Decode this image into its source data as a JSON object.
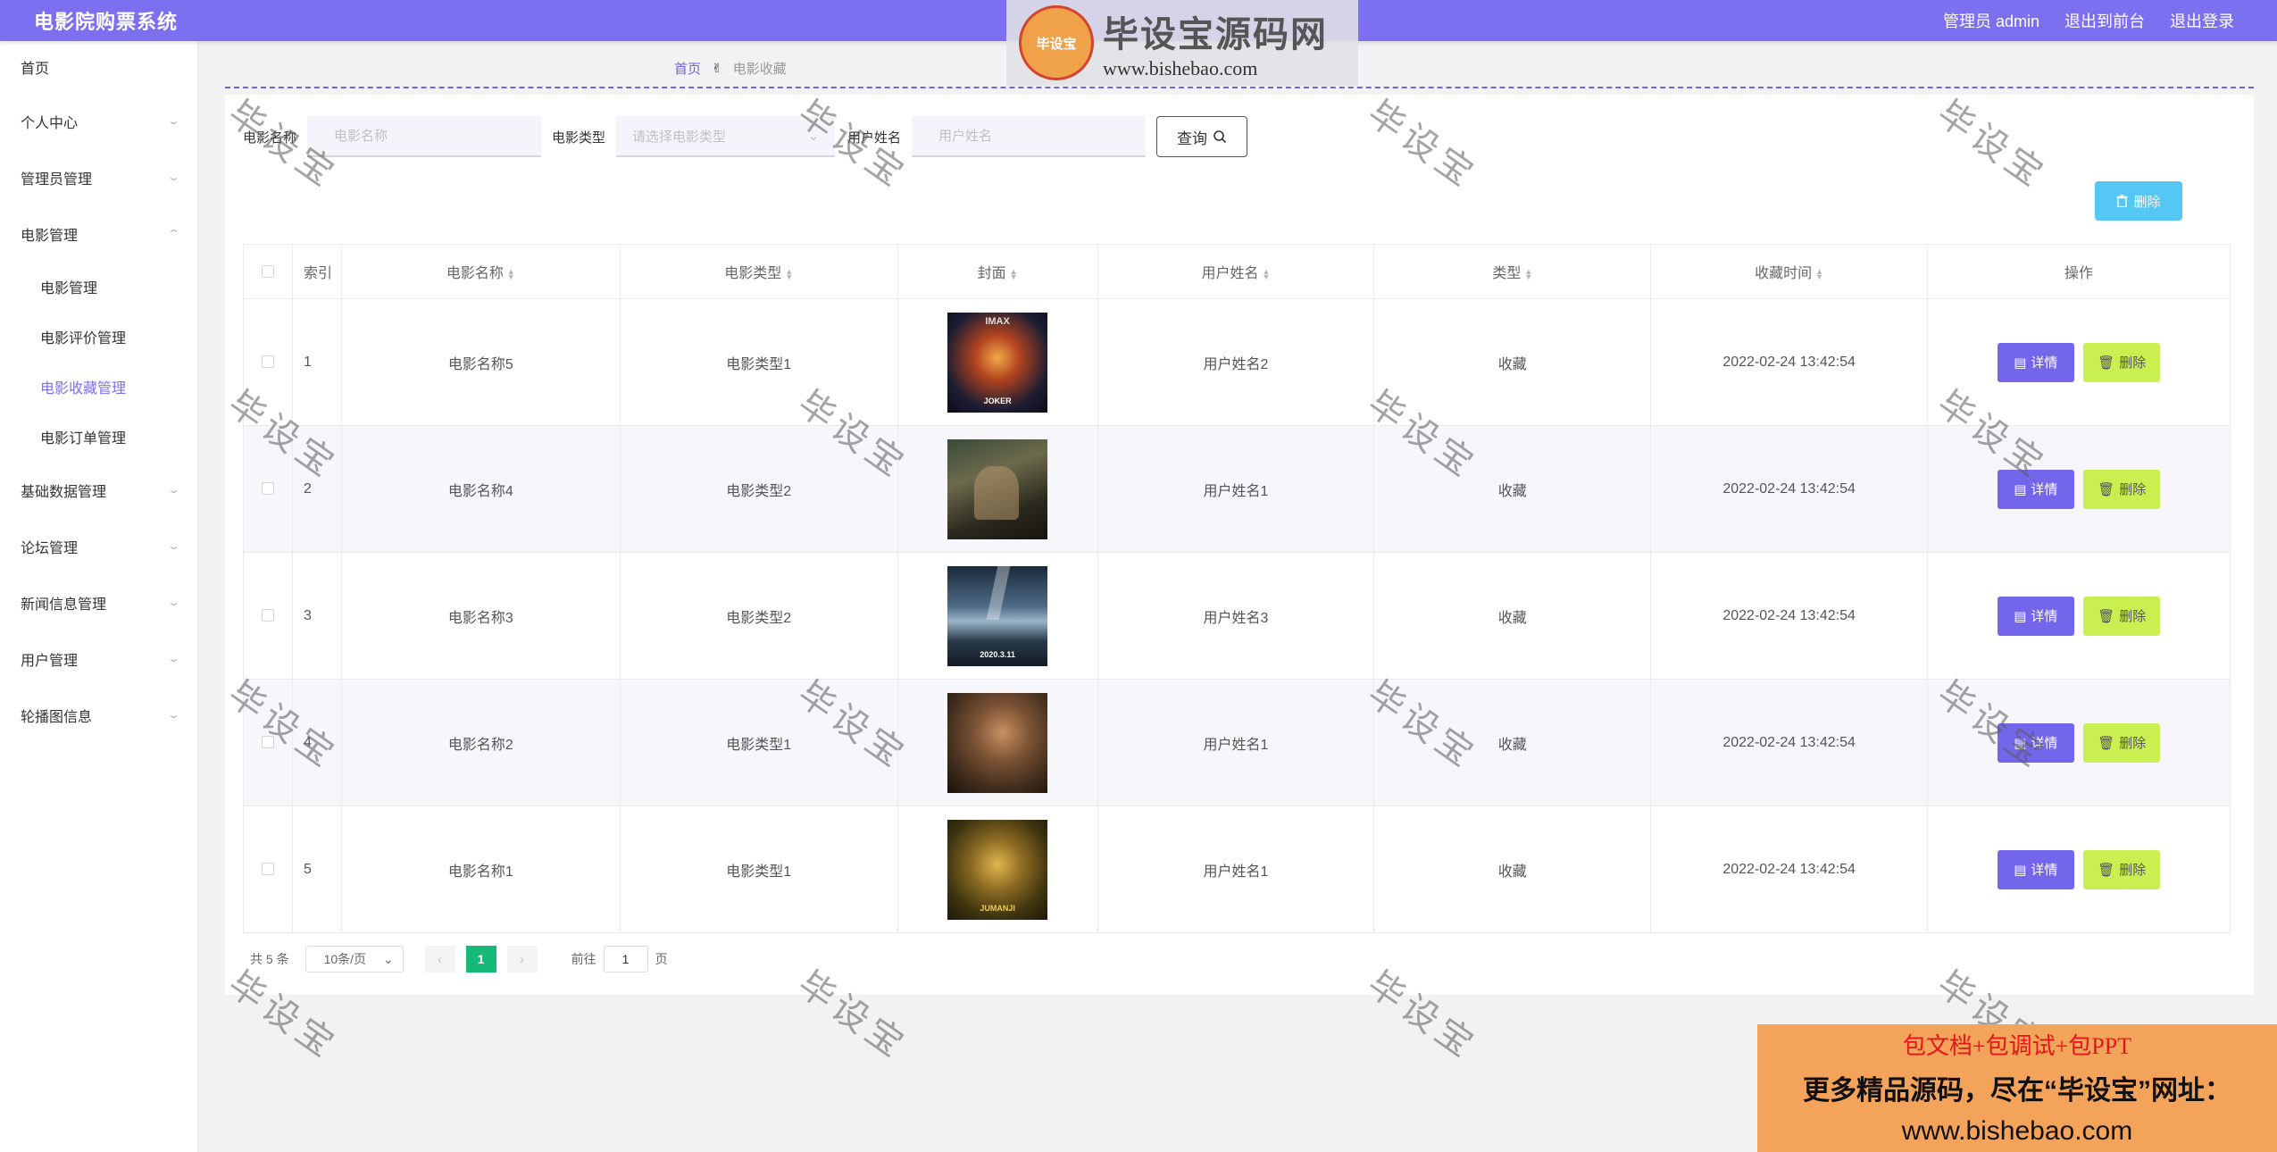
{
  "header": {
    "app_title": "电影院购票系统",
    "admin_label": "管理员 admin",
    "to_front": "退出到前台",
    "logout": "退出登录"
  },
  "sidebar": {
    "items": [
      {
        "label": "首页",
        "has_children": false
      },
      {
        "label": "个人中心",
        "has_children": true
      },
      {
        "label": "管理员管理",
        "has_children": true
      },
      {
        "label": "电影管理",
        "has_children": true,
        "expanded": true,
        "children": [
          "电影管理",
          "电影评价管理",
          "电影收藏管理",
          "电影订单管理"
        ],
        "active_child": 2
      },
      {
        "label": "基础数据管理",
        "has_children": true
      },
      {
        "label": "论坛管理",
        "has_children": true
      },
      {
        "label": "新闻信息管理",
        "has_children": true
      },
      {
        "label": "用户管理",
        "has_children": true
      },
      {
        "label": "轮播图信息",
        "has_children": true
      }
    ]
  },
  "breadcrumb": {
    "home": "首页",
    "current": "电影收藏"
  },
  "search": {
    "movie_name_label": "电影名称",
    "movie_name_placeholder": "电影名称",
    "movie_type_label": "电影类型",
    "movie_type_placeholder": "请选择电影类型",
    "user_name_label": "用户姓名",
    "user_name_placeholder": "用户姓名",
    "query_button": "查询"
  },
  "toolbar": {
    "delete_label": "删除"
  },
  "table": {
    "columns": [
      "索引",
      "电影名称",
      "电影类型",
      "封面",
      "用户姓名",
      "类型",
      "收藏时间",
      "操作"
    ],
    "rows": [
      {
        "index": "1",
        "movie_name": "电影名称5",
        "movie_type": "电影类型1",
        "cover_caption": "JOKER",
        "user_name": "用户姓名2",
        "type": "收藏",
        "time": "2022-02-24 13:42:54"
      },
      {
        "index": "2",
        "movie_name": "电影名称4",
        "movie_type": "电影类型2",
        "cover_caption": "",
        "user_name": "用户姓名1",
        "type": "收藏",
        "time": "2022-02-24 13:42:54"
      },
      {
        "index": "3",
        "movie_name": "电影名称3",
        "movie_type": "电影类型2",
        "cover_caption": "2020.3.11",
        "user_name": "用户姓名3",
        "type": "收藏",
        "time": "2022-02-24 13:42:54"
      },
      {
        "index": "4",
        "movie_name": "电影名称2",
        "movie_type": "电影类型1",
        "cover_caption": "",
        "user_name": "用户姓名1",
        "type": "收藏",
        "time": "2022-02-24 13:42:54"
      },
      {
        "index": "5",
        "movie_name": "电影名称1",
        "movie_type": "电影类型1",
        "cover_caption": "JUMANJI",
        "user_name": "用户姓名1",
        "type": "收藏",
        "time": "2022-02-24 13:42:54"
      }
    ],
    "detail_label": "详情",
    "delete_label": "删除"
  },
  "pagination": {
    "total": "共 5 条",
    "page_size": "10条/页",
    "current_page": "1",
    "goto_label": "前往",
    "goto_value": "1",
    "page_unit": "页"
  },
  "watermark": {
    "text": "毕设宝",
    "logo_badge": "毕设宝",
    "logo_title": "毕设宝源码网",
    "logo_url": "www.bishebao.com"
  },
  "promo": {
    "line1": "包文档+包调试+包PPT",
    "line2": "更多精品源码，尽在“毕设宝”网址：",
    "line3": "www.bishebao.com"
  },
  "colors": {
    "accent": "#7c6ff0",
    "detail_button": "#7466ea",
    "delete_button": "#c9f050",
    "top_delete_button": "#55c7f5",
    "pager_active": "#17b978"
  }
}
